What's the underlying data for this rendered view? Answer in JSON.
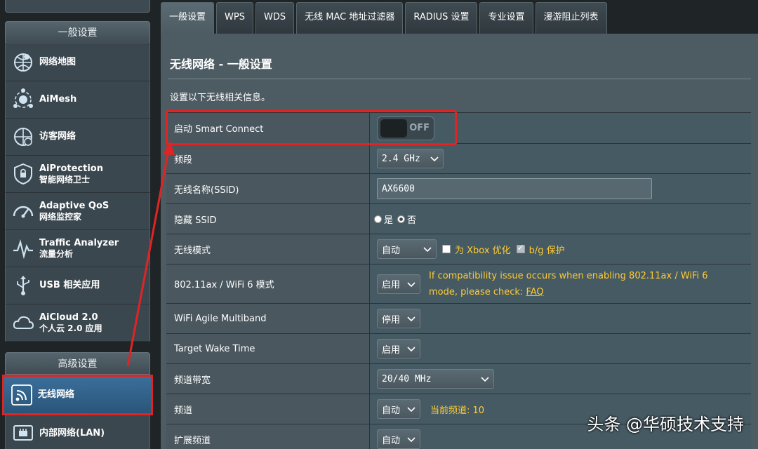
{
  "colors": {
    "panel": "#4d5b62",
    "value_cell": "#465a64",
    "highlight": "#e02424",
    "warning_text": "#ffcc33",
    "active_nav": "#2a557a"
  },
  "sidebar": {
    "general_header": "一般设置",
    "general_items": [
      {
        "icon": "network-map-icon",
        "l1": "网络地图",
        "l2": ""
      },
      {
        "icon": "aimesh-icon",
        "l1": "AiMesh",
        "l2": ""
      },
      {
        "icon": "guest-network-icon",
        "l1": "访客网络",
        "l2": ""
      },
      {
        "icon": "aiprotection-shield-icon",
        "l1": "AiProtection",
        "l2": "智能网络卫士"
      },
      {
        "icon": "qos-gauge-icon",
        "l1": "Adaptive QoS",
        "l2": "网络监控家"
      },
      {
        "icon": "traffic-analyzer-icon",
        "l1": "Traffic Analyzer",
        "l2": "流量分析"
      },
      {
        "icon": "usb-icon",
        "l1": "USB 相关应用",
        "l2": ""
      },
      {
        "icon": "aicloud-icon",
        "l1": "AiCloud 2.0",
        "l2": "个人云 2.0 应用"
      }
    ],
    "advanced_header": "高级设置",
    "advanced_items": [
      {
        "icon": "wireless-icon",
        "l1": "无线网络",
        "l2": ""
      },
      {
        "icon": "lan-icon",
        "l1": "内部网络(LAN)",
        "l2": ""
      }
    ]
  },
  "tabs": [
    "一般设置",
    "WPS",
    "WDS",
    "无线 MAC 地址过滤器",
    "RADIUS 设置",
    "专业设置",
    "漫游阻止列表"
  ],
  "page": {
    "title": "无线网络 - 一般设置",
    "description": "设置以下无线相关信息。"
  },
  "settings": {
    "smart_connect": {
      "label": "启动 Smart Connect",
      "state": "OFF"
    },
    "band": {
      "label": "频段",
      "value": "2.4 GHz"
    },
    "ssid": {
      "label": "无线名称(SSID)",
      "value": "AX6600"
    },
    "hide_ssid": {
      "label": "隐藏 SSID",
      "yes": "是",
      "no": "否"
    },
    "wireless_mode": {
      "label": "无线模式",
      "value": "自动",
      "xbox": "为 Xbox 优化",
      "bg": "b/g 保护"
    },
    "wifi6": {
      "label": "802.11ax / WiFi 6 模式",
      "value": "启用",
      "note": "If compatibility issue occurs when enabling 802.11ax / WiFi 6 mode, please check: ",
      "faq": "FAQ"
    },
    "agile": {
      "label": "WiFi Agile Multiband",
      "value": "停用"
    },
    "twt": {
      "label": "Target Wake Time",
      "value": "启用"
    },
    "bandwidth": {
      "label": "频道带宽",
      "value": "20/40 MHz"
    },
    "channel": {
      "label": "频道",
      "value": "自动",
      "current": "当前频道: 10"
    },
    "ext_channel": {
      "label": "扩展频道",
      "value": "自动"
    }
  },
  "watermark": "头条 @华硕技术支持"
}
